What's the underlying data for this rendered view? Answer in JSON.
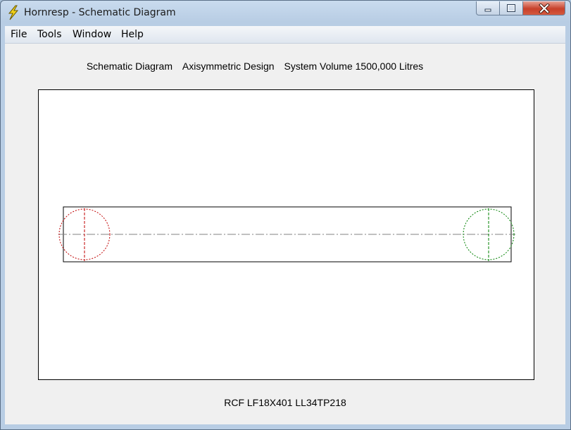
{
  "window": {
    "title": "Hornresp - Schematic Diagram",
    "icon": "lightning-bolt-icon",
    "controls": [
      "minimize-icon",
      "maximize-icon",
      "close-icon"
    ]
  },
  "menu": {
    "file": "File",
    "tools": "Tools",
    "window": "Window",
    "help": "Help"
  },
  "heading": {
    "part1": "Schematic Diagram",
    "part2": "Axisymmetric Design",
    "part3": "System Volume 1500,000 Litres"
  },
  "diagram": {
    "throat_color": "#c00000",
    "mouth_color": "#008000",
    "centerline_color": "#808080"
  },
  "footer": {
    "label": "RCF LF18X401 LL34TP218"
  },
  "colors": {
    "close_button": "#c7402a",
    "titlebar": "#c9dbee"
  }
}
